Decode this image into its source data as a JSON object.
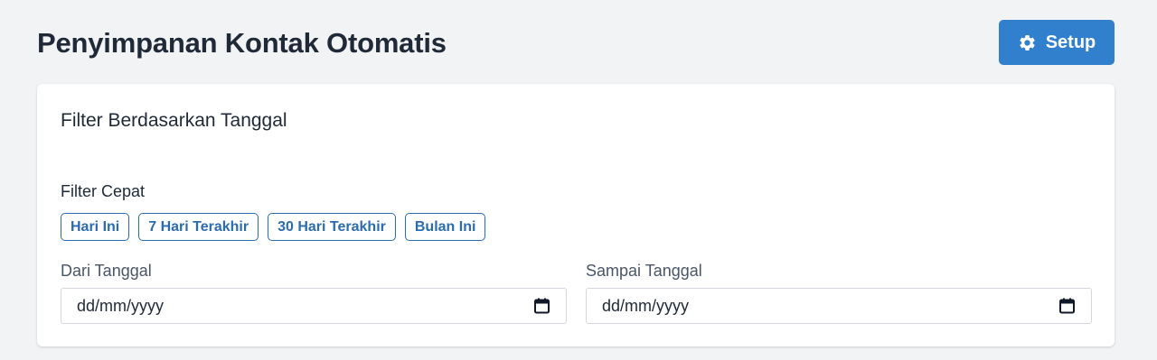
{
  "header": {
    "title": "Penyimpanan Kontak Otomatis",
    "setup_label": "Setup",
    "setup_icon": "gear-icon",
    "accent_color": "#3180ce"
  },
  "filter_card": {
    "title": "Filter Berdasarkan Tanggal",
    "quick_filter_label": "Filter Cepat",
    "quick_filters": [
      {
        "label": "Hari Ini"
      },
      {
        "label": "7 Hari Terakhir"
      },
      {
        "label": "30 Hari Terakhir"
      },
      {
        "label": "Bulan Ini"
      }
    ],
    "from_date": {
      "label": "Dari Tanggal",
      "placeholder": "dd/mm/yyyy",
      "icon": "calendar-icon"
    },
    "to_date": {
      "label": "Sampai Tanggal",
      "placeholder": "dd/mm/yyyy",
      "icon": "calendar-icon"
    }
  }
}
